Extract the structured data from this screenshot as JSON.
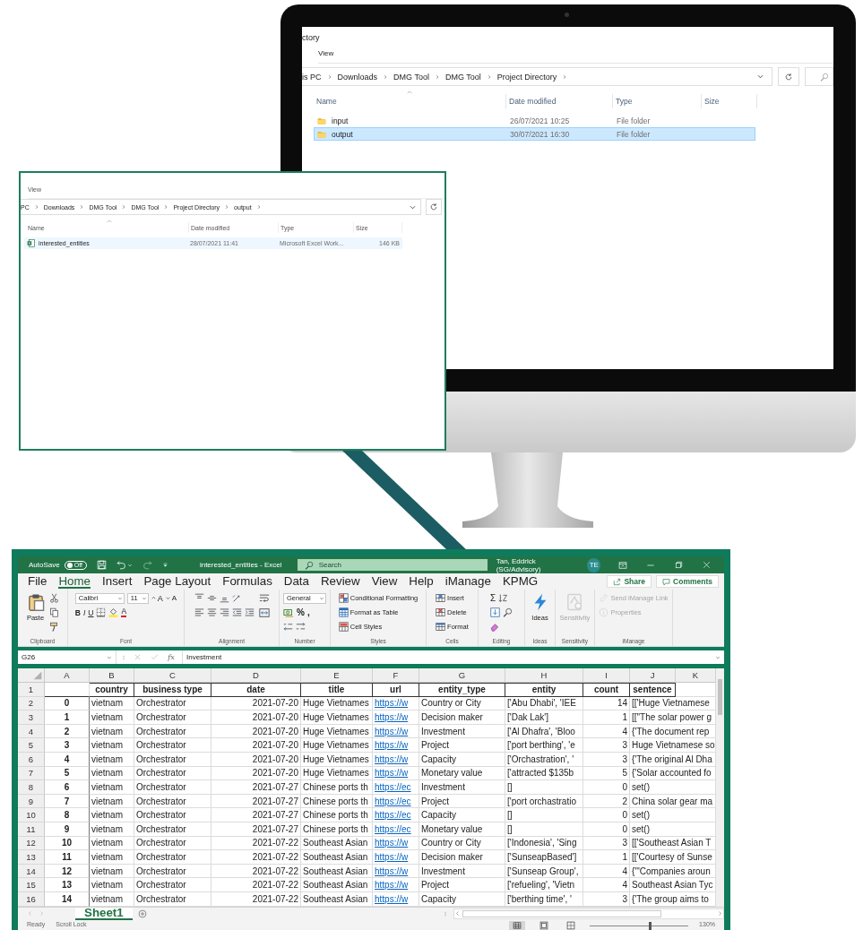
{
  "monitor_explorer": {
    "title": "ctory",
    "menu": [
      "View"
    ],
    "path": [
      "is PC",
      "Downloads",
      "DMG Tool",
      "DMG Tool",
      "Project Directory"
    ],
    "columns": [
      "Name",
      "Date modified",
      "Type",
      "Size"
    ],
    "files": [
      {
        "kind": "folder",
        "name": "input",
        "date": "26/07/2021 10:25",
        "type": "File folder",
        "selected": false,
        "hovered": false
      },
      {
        "kind": "folder",
        "name": "output",
        "date": "30/07/2021 16:30",
        "type": "File folder",
        "selected": true,
        "hovered": false
      }
    ]
  },
  "output_explorer": {
    "menu": [
      "View"
    ],
    "path": [
      "PC",
      "Downloads",
      "DMG Tool",
      "DMG Tool",
      "Project Directory",
      "output"
    ],
    "columns": [
      "Name",
      "Date modified",
      "Type",
      "Size"
    ],
    "files": [
      {
        "kind": "excel",
        "name": "interested_entities",
        "date": "28/07/2021 11:41",
        "type": "Microsoft Excel Work...",
        "size": "146 KB",
        "selected": false,
        "hovered": true
      }
    ]
  },
  "excel": {
    "autosave_label": "AutoSave",
    "autosave": {
      "on": false,
      "label": "Off"
    },
    "title": "interested_entities  -  Excel",
    "search": {
      "placeholder": "Search"
    },
    "user": {
      "name": "Tan, Eddrick (SG/Advisory)",
      "initials": "TE"
    },
    "tabs": [
      {
        "label": "File",
        "selected": false
      },
      {
        "label": "Home",
        "selected": true
      },
      {
        "label": "Insert",
        "selected": false
      },
      {
        "label": "Page Layout",
        "selected": false
      },
      {
        "label": "Formulas",
        "selected": false
      },
      {
        "label": "Data",
        "selected": false
      },
      {
        "label": "Review",
        "selected": false
      },
      {
        "label": "View",
        "selected": false
      },
      {
        "label": "Help",
        "selected": false
      },
      {
        "label": "iManage",
        "selected": false
      },
      {
        "label": "KPMG",
        "selected": false
      }
    ],
    "share": "Share",
    "comments": "Comments",
    "ribbon_groups": [
      {
        "label": "Clipboard",
        "disabled": false,
        "columns": [
          [
            [
              {
                "kind": "paste",
                "text": "Paste"
              }
            ]
          ],
          [
            [
              {
                "kind": "cut"
              }
            ],
            [
              {
                "kind": "copy"
              }
            ],
            [
              {
                "kind": "painter"
              }
            ]
          ]
        ]
      },
      {
        "label": "Font",
        "disabled": false,
        "columns": [
          [
            [
              {
                "kind": "font-box",
                "text": "Calibri"
              },
              {
                "kind": "size-box",
                "text": "11"
              },
              {
                "kind": "grow",
                "text": "A"
              },
              {
                "kind": "shrink",
                "text": "A"
              }
            ],
            [
              {
                "kind": "bold",
                "text": "B"
              },
              {
                "kind": "italic",
                "text": "I"
              },
              {
                "kind": "underline",
                "text": "U"
              },
              {
                "kind": "borders"
              },
              {
                "kind": "fill"
              },
              {
                "kind": "font-color",
                "text": "A"
              }
            ]
          ]
        ]
      },
      {
        "label": "Alignment",
        "disabled": false,
        "columns": [
          [
            [
              {
                "kind": "align-top"
              },
              {
                "kind": "align-middle"
              },
              {
                "kind": "align-bottom"
              },
              {
                "kind": "orientation"
              }
            ],
            [
              {
                "kind": "align-left"
              },
              {
                "kind": "align-center"
              },
              {
                "kind": "align-right"
              },
              {
                "kind": "outdent"
              },
              {
                "kind": "indent"
              }
            ]
          ],
          [
            [
              {
                "kind": "wrap"
              }
            ],
            [
              {
                "kind": "merge"
              }
            ]
          ]
        ]
      },
      {
        "label": "Number",
        "disabled": false,
        "columns": [
          [
            [
              {
                "kind": "number-box",
                "text": "General"
              }
            ],
            [
              {
                "kind": "currency"
              },
              {
                "kind": "percent",
                "text": "%"
              },
              {
                "kind": "comma",
                "text": ","
              }
            ],
            [
              {
                "kind": "inc-decimal"
              },
              {
                "kind": "dec-decimal"
              }
            ]
          ]
        ]
      },
      {
        "label": "Styles",
        "disabled": false,
        "columns": [
          [
            [
              {
                "kind": "cond",
                "text": "Conditional Formatting"
              }
            ],
            [
              {
                "kind": "table",
                "text": "Format as Table"
              }
            ],
            [
              {
                "kind": "cellstyles",
                "text": "Cell Styles"
              }
            ]
          ]
        ]
      },
      {
        "label": "Cells",
        "disabled": false,
        "columns": [
          [
            [
              {
                "kind": "insert",
                "text": "Insert"
              }
            ],
            [
              {
                "kind": "delete",
                "text": "Delete"
              }
            ],
            [
              {
                "kind": "format",
                "text": "Format"
              }
            ]
          ]
        ]
      },
      {
        "label": "Editing",
        "disabled": false,
        "columns": [
          [
            [
              {
                "kind": "sum",
                "text": "Σ"
              },
              {
                "kind": "sort"
              }
            ],
            [
              {
                "kind": "fill-down"
              },
              {
                "kind": "find"
              }
            ],
            [
              {
                "kind": "clear"
              }
            ]
          ]
        ]
      },
      {
        "label": "Ideas",
        "disabled": false,
        "columns": [
          [
            [
              {
                "kind": "ideas",
                "text": "Ideas"
              }
            ]
          ]
        ]
      },
      {
        "label": "Sensitivity",
        "disabled": true,
        "columns": [
          [
            [
              {
                "kind": "sensitivity",
                "text": "Sensitivity"
              }
            ]
          ]
        ]
      },
      {
        "label": "iManage",
        "disabled": true,
        "columns": [
          [
            [
              {
                "kind": "imanage-link",
                "text": "Send iManage Link"
              }
            ],
            [
              {
                "kind": "properties",
                "text": "Properties"
              }
            ]
          ]
        ]
      }
    ],
    "name_box": "G26",
    "fx": "fx",
    "formula": "Investment",
    "columns": [
      {
        "letter": "A",
        "kind": "index"
      },
      {
        "letter": "B",
        "heading": "country",
        "kind": "text"
      },
      {
        "letter": "C",
        "heading": "business type",
        "kind": "text"
      },
      {
        "letter": "D",
        "heading": "date",
        "kind": "date"
      },
      {
        "letter": "E",
        "heading": "title",
        "kind": "text"
      },
      {
        "letter": "F",
        "heading": "url",
        "kind": "link"
      },
      {
        "letter": "G",
        "heading": "entity_type",
        "kind": "text"
      },
      {
        "letter": "H",
        "heading": "entity",
        "kind": "text"
      },
      {
        "letter": "I",
        "heading": "count",
        "kind": "number"
      },
      {
        "letter": "J",
        "heading": "sentence",
        "kind": "text"
      },
      {
        "letter": "K",
        "kind": "text"
      }
    ],
    "header_row_number": "1",
    "rows": [
      {
        "number": "2",
        "cells": [
          "0",
          "vietnam",
          "Orchestrator",
          "2021-07-20",
          "Huge Vietnames",
          "https://w",
          "Country or City",
          "['Abu Dhabi', 'IEE",
          "14",
          "[['Huge Vietnamese"
        ]
      },
      {
        "number": "3",
        "cells": [
          "1",
          "vietnam",
          "Orchestrator",
          "2021-07-20",
          "Huge Vietnames",
          "https://w",
          "Decision maker",
          "['Dak Lak']",
          "1",
          "[[\"The solar power g"
        ]
      },
      {
        "number": "4",
        "cells": [
          "2",
          "vietnam",
          "Orchestrator",
          "2021-07-20",
          "Huge Vietnames",
          "https://w",
          "Investment",
          "['Al Dhafra', 'Bloo",
          "4",
          "{'The document rep"
        ]
      },
      {
        "number": "5",
        "cells": [
          "3",
          "vietnam",
          "Orchestrator",
          "2021-07-20",
          "Huge Vietnames",
          "https://w",
          "Project",
          "['port berthing', 'e",
          "3",
          "Huge Vietnamese so"
        ]
      },
      {
        "number": "6",
        "cells": [
          "4",
          "vietnam",
          "Orchestrator",
          "2021-07-20",
          "Huge Vietnames",
          "https://w",
          "Capacity",
          "['Orchastration', '",
          "3",
          "{'The original Al Dha"
        ]
      },
      {
        "number": "7",
        "cells": [
          "5",
          "vietnam",
          "Orchestrator",
          "2021-07-20",
          "Huge Vietnames",
          "https://w",
          "Monetary value",
          "['attracted $135b",
          "5",
          "{'Solar accounted fo"
        ]
      },
      {
        "number": "8",
        "cells": [
          "6",
          "vietnam",
          "Orchestrator",
          "2021-07-27",
          "Chinese ports th",
          "https://ec",
          "Investment",
          "[]",
          "0",
          "set()"
        ]
      },
      {
        "number": "9",
        "cells": [
          "7",
          "vietnam",
          "Orchestrator",
          "2021-07-27",
          "Chinese ports th",
          "https://ec",
          "Project",
          "['port orchastratio",
          "2",
          "China solar gear ma"
        ]
      },
      {
        "number": "10",
        "cells": [
          "8",
          "vietnam",
          "Orchestrator",
          "2021-07-27",
          "Chinese ports th",
          "https://ec",
          "Capacity",
          "[]",
          "0",
          "set()"
        ]
      },
      {
        "number": "11",
        "cells": [
          "9",
          "vietnam",
          "Orchestrator",
          "2021-07-27",
          "Chinese ports th",
          "https://ec",
          "Monetary value",
          "[]",
          "0",
          "set()"
        ]
      },
      {
        "number": "12",
        "cells": [
          "10",
          "vietnam",
          "Orchestrator",
          "2021-07-22",
          "Southeast Asian",
          "https://w",
          "Country or City",
          "['Indonesia', 'Sing",
          "3",
          "[['Southeast Asian T"
        ]
      },
      {
        "number": "13",
        "cells": [
          "11",
          "vietnam",
          "Orchestrator",
          "2021-07-22",
          "Southeast Asian",
          "https://w",
          "Decision maker",
          "['SunseapBased']",
          "1",
          "[['Courtesy of Sunse"
        ]
      },
      {
        "number": "14",
        "cells": [
          "12",
          "vietnam",
          "Orchestrator",
          "2021-07-22",
          "Southeast Asian",
          "https://w",
          "Investment",
          "['Sunseap Group',",
          "4",
          "{'\"Companies aroun"
        ]
      },
      {
        "number": "15",
        "cells": [
          "13",
          "vietnam",
          "Orchestrator",
          "2021-07-22",
          "Southeast Asian",
          "https://w",
          "Project",
          "['refueling', 'Vietn",
          "4",
          "Southeast Asian Tyc"
        ]
      },
      {
        "number": "16",
        "cells": [
          "14",
          "vietnam",
          "Orchestrator",
          "2021-07-22",
          "Southeast Asian",
          "https://w",
          "Capacity",
          "['berthing time', '",
          "3",
          "{'The group aims to"
        ]
      }
    ],
    "sheet_tabs": [
      {
        "label": "Sheet1",
        "selected": true
      }
    ],
    "status": [
      "Ready",
      "Scroll Lock"
    ],
    "zoom_slider": {
      "level": 0.6
    },
    "zoom": "130%"
  }
}
